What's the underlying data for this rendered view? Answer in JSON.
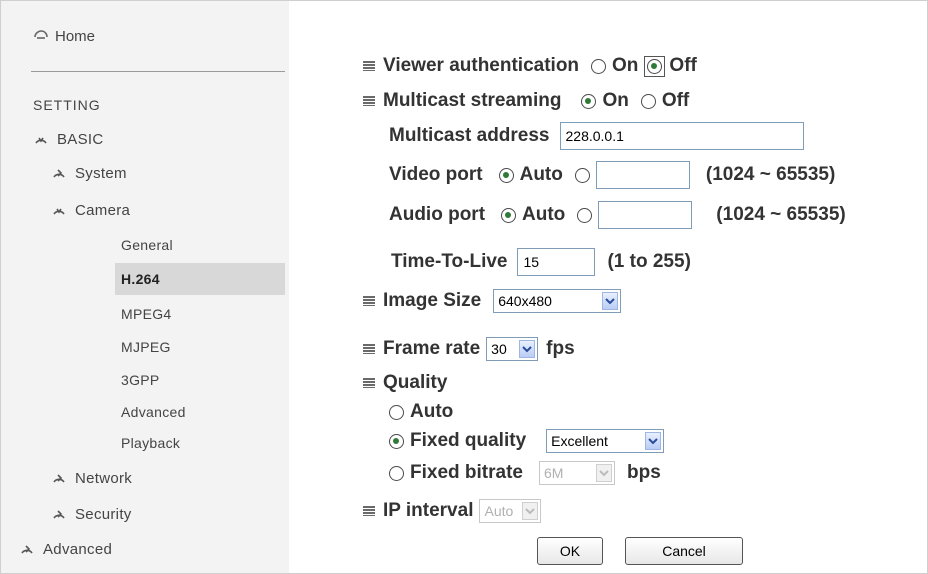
{
  "sidebar": {
    "home": "Home",
    "setting": "SETTING",
    "items": [
      {
        "label": "BASIC"
      },
      {
        "label": "System"
      },
      {
        "label": "Camera"
      },
      {
        "label": "General"
      },
      {
        "label": "H.264"
      },
      {
        "label": "MPEG4"
      },
      {
        "label": "MJPEG"
      },
      {
        "label": "3GPP"
      },
      {
        "label": "Advanced"
      },
      {
        "label": "Playback"
      },
      {
        "label": "Network"
      },
      {
        "label": "Security"
      },
      {
        "label": "Advanced"
      }
    ]
  },
  "form": {
    "viewer_auth": {
      "label": "Viewer authentication",
      "on": "On",
      "off": "Off",
      "selected": "Off"
    },
    "multicast": {
      "label": "Multicast streaming",
      "on": "On",
      "off": "Off",
      "selected": "On"
    },
    "multicast_address": {
      "label": "Multicast address",
      "value": "228.0.0.1"
    },
    "video_port": {
      "label": "Video port",
      "auto": "Auto",
      "value": "",
      "range": "(1024 ~ 65535)"
    },
    "audio_port": {
      "label": "Audio port",
      "auto": "Auto",
      "value": "",
      "range": "(1024 ~ 65535)"
    },
    "ttl": {
      "label": "Time-To-Live",
      "value": "15",
      "range": "(1 to 255)"
    },
    "image_size": {
      "label": "Image Size",
      "value": "640x480"
    },
    "frame_rate": {
      "label": "Frame rate",
      "value": "30",
      "unit": "fps"
    },
    "quality": {
      "label": "Quality",
      "auto": "Auto",
      "fixed_quality": "Fixed quality",
      "fixed_quality_value": "Excellent",
      "fixed_bitrate": "Fixed bitrate",
      "fixed_bitrate_value": "6M",
      "bitrate_unit": "bps",
      "selected": "Fixed quality"
    },
    "ip_interval": {
      "label": "IP interval",
      "value": "Auto"
    }
  },
  "buttons": {
    "ok": "OK",
    "cancel": "Cancel"
  }
}
